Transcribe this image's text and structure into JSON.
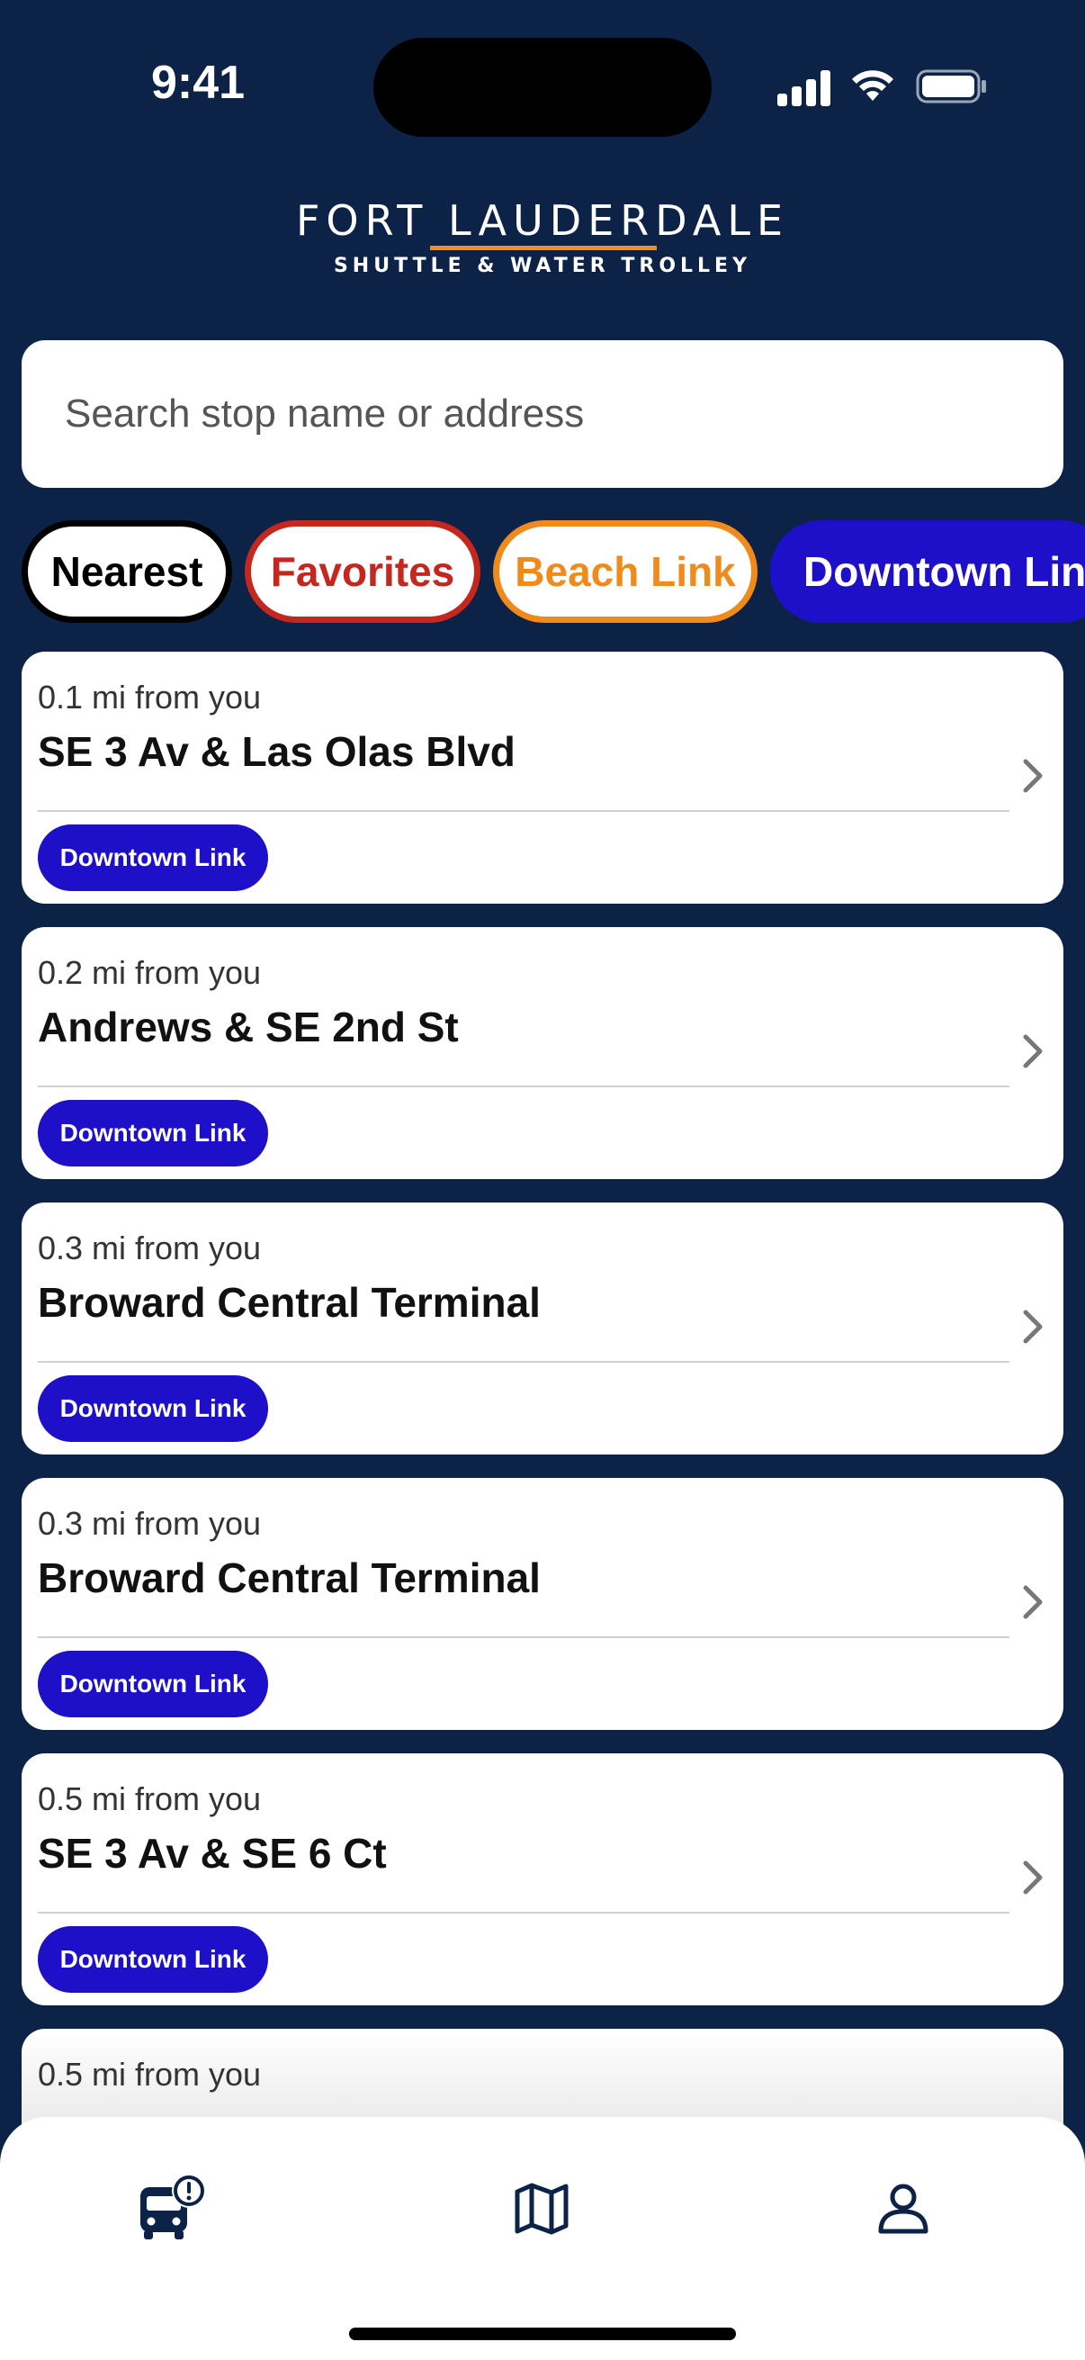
{
  "status_bar": {
    "time": "9:41"
  },
  "brand": {
    "title": "FORT LAUDERDALE",
    "subtitle": "SHUTTLE & WATER TROLLEY",
    "accent": "#f28c1a"
  },
  "search": {
    "placeholder": "Search stop name or address",
    "value": ""
  },
  "filters": [
    {
      "label": "Nearest",
      "selected": true,
      "color": "#000000"
    },
    {
      "label": "Favorites",
      "selected": false,
      "color": "#c4271e"
    },
    {
      "label": "Beach Link",
      "selected": false,
      "color": "#f08a1c"
    },
    {
      "label": "Downtown Lin",
      "selected": false,
      "color": "#1e10c8"
    }
  ],
  "stops": [
    {
      "distance": "0.1 mi from you",
      "name": "SE 3 Av & Las Olas Blvd",
      "route": "Downtown Link"
    },
    {
      "distance": "0.2 mi from you",
      "name": "Andrews & SE 2nd St",
      "route": "Downtown Link"
    },
    {
      "distance": "0.3 mi from you",
      "name": "Broward Central Terminal",
      "route": "Downtown Link"
    },
    {
      "distance": "0.3 mi from you",
      "name": "Broward Central Terminal",
      "route": "Downtown Link"
    },
    {
      "distance": "0.5 mi from you",
      "name": "SE 3 Av & SE 6 Ct",
      "route": "Downtown Link"
    },
    {
      "distance": "0.5 mi from you"
    }
  ],
  "tabs": [
    {
      "icon": "bus-alert-icon",
      "active": true
    },
    {
      "icon": "map-icon",
      "active": false
    },
    {
      "icon": "user-icon",
      "active": false
    }
  ],
  "colors": {
    "background": "#0c2347",
    "route_badge": "#1e10c8",
    "icon": "#0c2347"
  }
}
